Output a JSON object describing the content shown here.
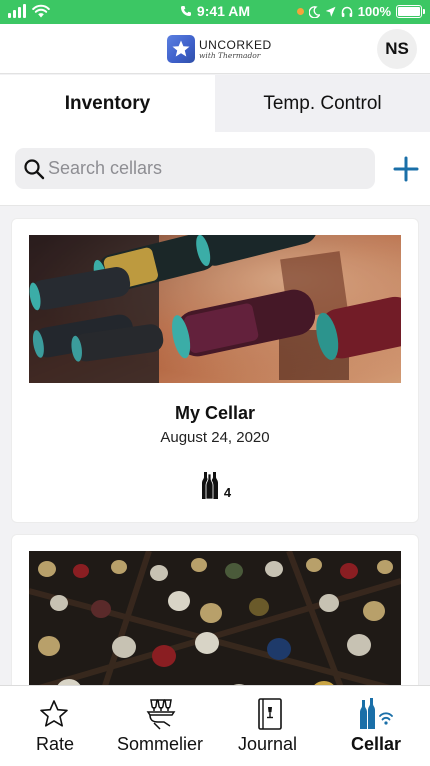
{
  "status_bar": {
    "time": "9:41 AM",
    "battery": "100%",
    "battery_level": 1.0,
    "bg_color": "#3cc764"
  },
  "header": {
    "logo_title": "UNCORKED",
    "logo_subtitle": "with Thermador",
    "avatar_initials": "NS"
  },
  "tabs": [
    {
      "label": "Inventory",
      "active": true
    },
    {
      "label": "Temp. Control",
      "active": false
    }
  ],
  "search": {
    "placeholder": "Search cellars",
    "value": ""
  },
  "accent_color": "#1a6fa8",
  "cellars": [
    {
      "name": "My Cellar",
      "date": "August 24, 2020",
      "bottle_count": "4",
      "icon": "wine-bottles-icon"
    },
    {
      "name": "",
      "date": "",
      "bottle_count": "",
      "icon": "wine-bottles-icon"
    }
  ],
  "bottom_nav": [
    {
      "label": "Rate",
      "icon": "star-icon",
      "active": false
    },
    {
      "label": "Sommelier",
      "icon": "sommelier-tray-icon",
      "active": false
    },
    {
      "label": "Journal",
      "icon": "journal-icon",
      "active": false
    },
    {
      "label": "Cellar",
      "icon": "cellar-bottles-wifi-icon",
      "active": true
    }
  ]
}
